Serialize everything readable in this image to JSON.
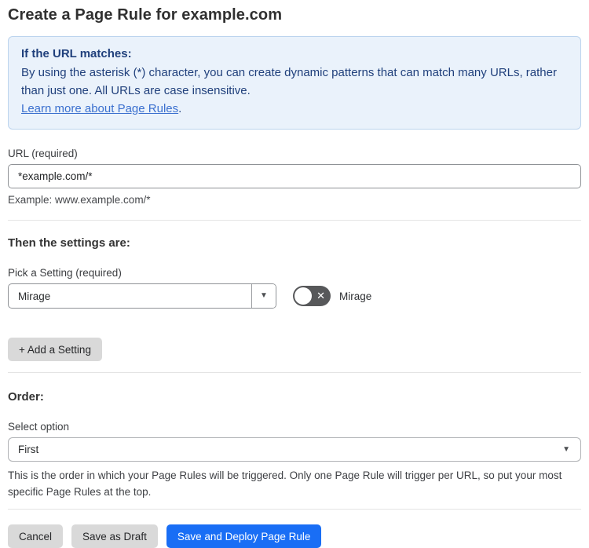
{
  "page": {
    "title": "Create a Page Rule for example.com"
  },
  "info_box": {
    "heading": "If the URL matches:",
    "body": "By using the asterisk (*) character, you can create dynamic patterns that can match many URLs, rather than just one. All URLs are case insensitive.",
    "link_text": "Learn more about Page Rules",
    "link_suffix": "."
  },
  "url_field": {
    "label": "URL (required)",
    "value": "*example.com/*",
    "hint": "Example: www.example.com/*"
  },
  "settings_section": {
    "heading": "Then the settings are:",
    "picker_label": "Pick a Setting (required)",
    "selected_setting": "Mirage",
    "toggle": {
      "label": "Mirage",
      "state": "off"
    },
    "add_setting_label": "+ Add a Setting"
  },
  "order_section": {
    "heading": "Order:",
    "select_label": "Select option",
    "selected_option": "First",
    "help_text": "This is the order in which your Page Rules will be triggered. Only one Page Rule will trigger per URL, so put your most specific Page Rules at the top."
  },
  "footer": {
    "cancel_label": "Cancel",
    "save_draft_label": "Save as Draft",
    "save_deploy_label": "Save and Deploy Page Rule"
  },
  "icons": {
    "dropdown_arrow": "▼",
    "toggle_x": "✕"
  },
  "colors": {
    "info_box_bg": "#eaf2fb",
    "info_box_border": "#bcd4ee",
    "info_text": "#20407c",
    "link_blue": "#3b70cf",
    "primary_button_blue": "#196ef5",
    "gray_button": "#d9d9d9",
    "toggle_off_bg": "#57585a"
  }
}
